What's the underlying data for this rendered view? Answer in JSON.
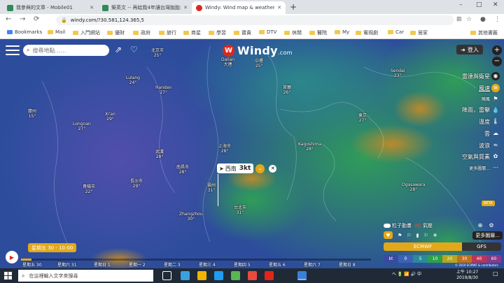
{
  "browser": {
    "tabs": [
      {
        "title": "我參與的文章 - Mobile01",
        "favicon_color": "#2e8b57"
      },
      {
        "title": "築英文 -- 再給我4年讓台灣脫胎換骨",
        "favicon_color": "#2e8b57"
      },
      {
        "title": "Windy: Wind map & weather f",
        "favicon_color": "#e0261b",
        "active": true
      }
    ],
    "new_tab": "+",
    "window_controls": [
      "–",
      "□",
      "✕"
    ],
    "url": "windy.com/?30.581,124.365,5",
    "bookmarks": [
      "Bookmarks",
      "Mail",
      "入門網站",
      "優財",
      "政府",
      "旅行",
      "商星",
      "學習",
      "寶貴",
      "DTV",
      "休閒",
      "醫院",
      "My",
      "電視劇",
      "Car",
      "居家"
    ],
    "other_bookmarks": "其他書籤"
  },
  "app": {
    "search_placeholder": "搜尋地點……",
    "logo": "Windy",
    "logo_suffix": ".com",
    "login_label": "登入",
    "zoom_in": "+",
    "zoom_out": "−",
    "layers": [
      {
        "label": "雷達與衛星"
      },
      {
        "label": "風速",
        "active": true
      },
      {
        "label": "陣風",
        "small": true
      },
      {
        "label": "降雨，雷擊"
      },
      {
        "label": "溫度"
      },
      {
        "label": "雲"
      },
      {
        "label": "波浪"
      },
      {
        "label": "空氣與質素"
      },
      {
        "label": "更多圖層...",
        "small": true
      }
    ],
    "beta_badge": "BETA",
    "picker": {
      "direction_arrow": "➤",
      "direction": "西南",
      "value": "3kt"
    },
    "timeline": {
      "current": "星期五 30 - 10:00",
      "days": [
        "星期五 30",
        "星期六 31",
        "星期日 1",
        "星期一 2",
        "星期二 3",
        "星期三 4",
        "星期四 5",
        "星期五 6",
        "星期六 7",
        "星期日 8"
      ],
      "progress": 0.03
    },
    "toggles": [
      {
        "label": "粒子動畫"
      },
      {
        "label": "氣壓"
      }
    ],
    "more_layers": "更多圖層...",
    "models": [
      "ECMWF",
      "GFS"
    ],
    "legend": {
      "unit": "kt",
      "values": [
        "0",
        "5",
        "10",
        "20",
        "30",
        "40",
        "60"
      ],
      "colors": [
        "#3a4a9f",
        "#3a63b5",
        "#2b8a9a",
        "#2ea04c",
        "#b7a61e",
        "#c1701e",
        "#b8365a",
        "#8a3a8a"
      ]
    },
    "credit": "© 2019 ECMWF & contributors",
    "cities": [
      {
        "name": "北京市",
        "temp": "25°"
      },
      {
        "name": "Dalian\n大連",
        "temp": ""
      },
      {
        "name": "中壢",
        "temp": "25°"
      },
      {
        "name": "首爾",
        "temp": "26°"
      },
      {
        "name": "Sendai",
        "temp": "23°"
      },
      {
        "name": "東京",
        "temp": "27°"
      },
      {
        "name": "Kagoshima",
        "temp": "28°"
      },
      {
        "name": "上海市",
        "temp": "28°"
      },
      {
        "name": "福州",
        "temp": "31°"
      },
      {
        "name": "台北市",
        "temp": "31°"
      },
      {
        "name": "Zhangzhou",
        "temp": "30°"
      },
      {
        "name": "武漢",
        "temp": "28°"
      },
      {
        "name": "長沙市",
        "temp": "29°"
      },
      {
        "name": "Longnan",
        "temp": "27°"
      },
      {
        "name": "Xi'an",
        "temp": "29°"
      },
      {
        "name": "蘭州",
        "temp": "15°"
      },
      {
        "name": "Lulang",
        "temp": "24°"
      },
      {
        "name": "貴陽市",
        "temp": "22°"
      },
      {
        "name": "Ogasawara",
        "temp": "28°"
      },
      {
        "name": "南昌市",
        "temp": "28°"
      },
      {
        "name": "Handan",
        "temp": "27°"
      }
    ]
  },
  "taskbar": {
    "search_placeholder": "在這裡輸入文字來搜尋",
    "app_colors": [
      "#3ba0e0",
      "#f0b400",
      "#1f9cf0",
      "#5ab552",
      "#e74c3c",
      "#e0261b",
      "#3b7fd7"
    ],
    "tray_text": "へ 🔋 📶 🔊 中",
    "time": "上午 10:27",
    "date": "2019/8/30"
  }
}
